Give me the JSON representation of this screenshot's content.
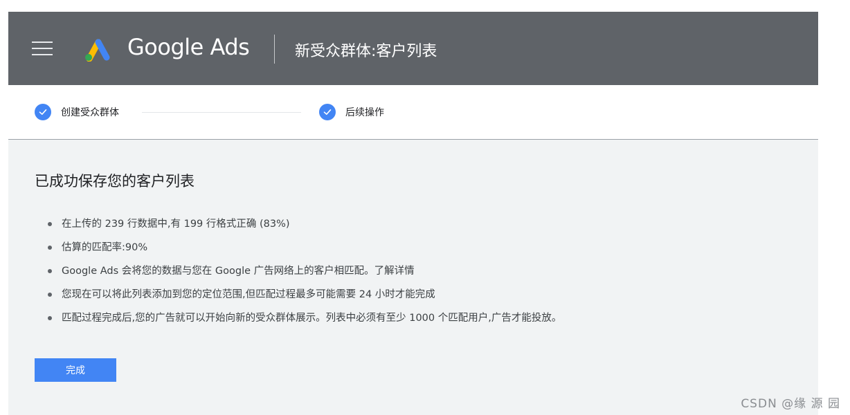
{
  "header": {
    "brand": "Google Ads",
    "title": "新受众群体:客户列表"
  },
  "stepper": {
    "steps": [
      {
        "label": "创建受众群体",
        "status": "completed"
      },
      {
        "label": "后续操作",
        "status": "completed"
      }
    ]
  },
  "main": {
    "title": "已成功保存您的客户列表",
    "bullets": [
      {
        "text": "在上传的 239 行数据中,有 199 行格式正确 (83%)"
      },
      {
        "text": "估算的匹配率:90%"
      },
      {
        "text": "Google Ads 会将您的数据与您在 Google 广告网络上的客户相匹配。",
        "link": "了解详情"
      },
      {
        "text": "您现在可以将此列表添加到您的定位范围,但匹配过程最多可能需要 24 小时才能完成"
      },
      {
        "text": "匹配过程完成后,您的广告就可以开始向新的受众群体展示。列表中必须有至少 1000 个匹配用户,广告才能投放。"
      }
    ],
    "done_label": "完成"
  },
  "watermark": "CSDN @缘 源 园",
  "colors": {
    "header_bg": "#5f6368",
    "accent": "#4285f4",
    "content_bg": "#f1f3f4"
  }
}
